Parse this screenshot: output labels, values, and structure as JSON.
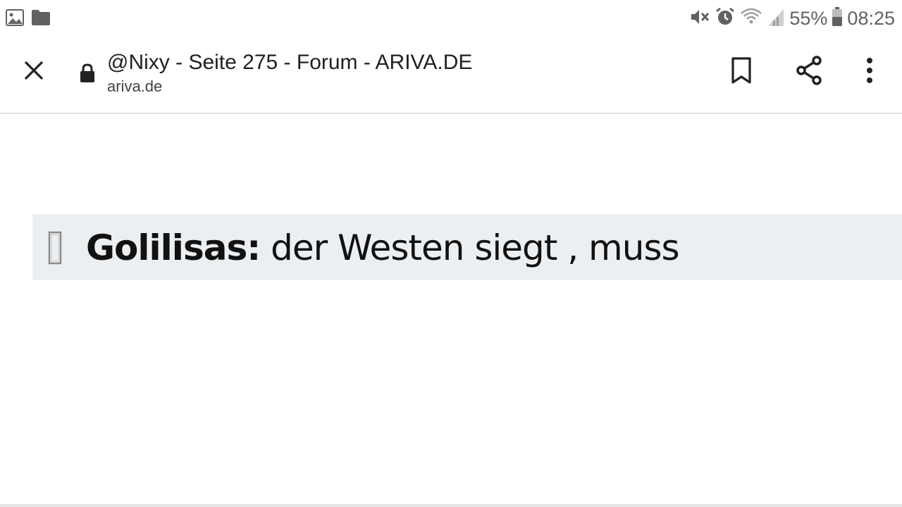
{
  "status_bar": {
    "left_icons": [
      "image-icon",
      "folder-icon"
    ],
    "right_icons": [
      "mute-icon",
      "alarm-icon",
      "wifi-icon",
      "signal-icon",
      "battery-icon"
    ],
    "battery_percent": "55%",
    "time": "08:25"
  },
  "toolbar": {
    "title": "@Nixy - Seite 275 - Forum - ARIVA.DE",
    "host": "ariva.de",
    "icons": [
      "close-icon",
      "lock-icon",
      "bookmark-icon",
      "share-icon",
      "more-vert-icon"
    ]
  },
  "content": {
    "quote": {
      "author": "Golilisas:",
      "text": " der Westen siegt , muss"
    }
  },
  "colors": {
    "quote_background": "#eceff2",
    "status_icon": "#616161",
    "text": "#111111"
  }
}
